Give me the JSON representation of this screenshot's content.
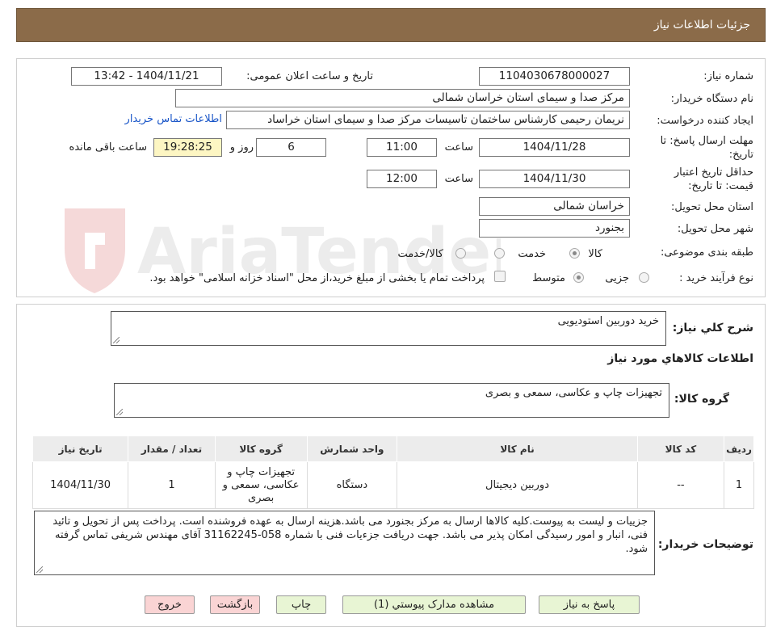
{
  "header": {
    "title": "جزئیات اطلاعات نیاز"
  },
  "form": {
    "need_number_label": "شماره نیاز:",
    "need_number": "1104030678000027",
    "announce_label": "تاریخ و ساعت اعلان عمومی:",
    "announce_value": "1404/11/21 - 13:42",
    "buyer_org_label": "نام دستگاه خریدار:",
    "buyer_org": "مرکز صدا و سیمای استان خراسان شمالی",
    "creator_label": "ایجاد کننده درخواست:",
    "creator": "نریمان رحیمی کارشناس ساختمان تاسیسات مرکز صدا و سیمای استان خراساد",
    "contact_link": "اطلاعات تماس خریدار",
    "reply_deadline_label_1": "مهلت ارسال پاسخ: تا",
    "reply_deadline_label_2": "تاریخ:",
    "reply_date": "1404/11/28",
    "time_label": "ساعت",
    "reply_time": "11:00",
    "days": "6",
    "days_label": "روز و",
    "remaining": "19:28:25",
    "remaining_label": "ساعت باقی مانده",
    "validity_label_1": "حداقل تاریخ اعتبار",
    "validity_label_2": "قیمت: تا تاریخ:",
    "validity_date": "1404/11/30",
    "validity_time_label": "ساعت",
    "validity_time": "12:00",
    "province_label": "استان محل تحویل:",
    "province": "خراسان شمالی",
    "city_label": "شهر محل تحویل:",
    "city": "بجنورد",
    "category_label": "طبقه بندی موضوعی:",
    "cat_goods": "کالا",
    "cat_service": "خدمت",
    "cat_goods_service": "کالا/خدمت",
    "process_label": "نوع فرآیند خرید :",
    "proc_partial": "جزیی",
    "proc_medium": "متوسط",
    "treasury_note": "پرداخت تمام یا بخشی از مبلغ خرید،از محل \"اسناد خزانه اسلامی\" خواهد بود."
  },
  "summary": {
    "label": "شرح کلي نياز:",
    "value": "خرید دوربین استودیویی",
    "goods_info_title": "اطلاعات کالاهاي مورد نياز",
    "group_label": "گروه کالا:",
    "group_value": "تجهیزات چاپ و عکاسی، سمعی و بصری"
  },
  "table": {
    "headers": [
      "ردیف",
      "کد کالا",
      "نام کالا",
      "واحد شمارش",
      "گروه کالا",
      "تعداد / مقدار",
      "تاریخ نیاز"
    ],
    "rows": [
      [
        "1",
        "--",
        "دوربین دیجیتال",
        "دستگاه",
        "تجهیزات چاپ و عکاسی، سمعی و بصری",
        "1",
        "1404/11/30"
      ]
    ]
  },
  "notes": {
    "label": "توضیحات خریدار:",
    "text": "جزییات و لیست به پیوست.کلیه کالاها ارسال به مرکز بجنورد می باشد.هزینه ارسال به عهده فروشنده است. پرداخت پس از تحویل و تائید فنی، انبار و امور رسیدگی امکان پذیر می باشد. جهت دریافت جزءیات فنی با شماره 058-31162245 آقای مهندس شریفی تماس گرفته شود."
  },
  "buttons": {
    "reply": "پاسخ به نياز",
    "attachments": "مشاهده مدارک پيوستي (1)",
    "print": "چاپ",
    "back": "بازگشت",
    "exit": "خروج"
  },
  "watermark": {
    "text": "AriaTender.neT"
  },
  "colors": {
    "header_bg": "#8b6b49",
    "link": "#1a56c8",
    "remaining_bg": "#fdf6c3",
    "button_green": "#e8f5d4",
    "button_pink": "#fad4d4"
  }
}
